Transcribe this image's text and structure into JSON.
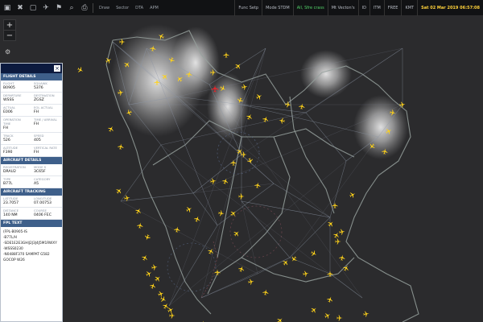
{
  "toolbar": {
    "left_icons": [
      {
        "icon": "layers-icon",
        "glyph": "▣"
      },
      {
        "icon": "trash-icon",
        "glyph": "✖"
      },
      {
        "icon": "delete-icon",
        "glyph": "▢"
      },
      {
        "icon": "route-icon",
        "glyph": "✈"
      },
      {
        "icon": "flag-icon",
        "glyph": "⚑"
      },
      {
        "icon": "search-icon",
        "glyph": "⌕"
      },
      {
        "icon": "print-icon",
        "glyph": "⎙"
      }
    ],
    "left_buttons": [
      "Draw",
      "Sector",
      "DTA",
      "APM"
    ],
    "right_items": [
      {
        "label": "Func Setp",
        "style": "normal"
      },
      {
        "label": "Mode STDM",
        "style": "normal"
      },
      {
        "label": "All, Sfre crass",
        "style": "green"
      },
      {
        "label": "Mt Vecton's",
        "style": "normal"
      },
      {
        "label": "ID",
        "style": "normal"
      },
      {
        "label": "ITM",
        "style": "normal"
      },
      {
        "label": "FREE",
        "style": "normal"
      },
      {
        "label": "KMT",
        "style": "normal"
      },
      {
        "label": "Sat 02 Mar 2019 06:57:08",
        "style": "clock"
      }
    ]
  },
  "map_controls": {
    "zoom_in": "+",
    "zoom_out": "−",
    "settings_icon": "gear-icon"
  },
  "panel": {
    "close_label": "×",
    "flight_details": {
      "heading": "FLIGHT DETAILS",
      "fields": [
        {
          "label": "FLIGHT",
          "value": "B0905"
        },
        {
          "label": "SQUAWK",
          "value": "5376"
        },
        {
          "label": "DEPARTURE",
          "value": "WSSS"
        },
        {
          "label": "DESTINATION",
          "value": "ZGSZ"
        },
        {
          "label": "ACTUAL",
          "value": "E006"
        },
        {
          "label": "EOL ACTUAL",
          "value": "FH"
        },
        {
          "label": "OPERATION TIME",
          "value": "FH"
        },
        {
          "label": "TIME / ARRIVAL",
          "value": "FH"
        },
        {
          "label": "TRACK",
          "value": "526"
        },
        {
          "label": "SPEED",
          "value": "405"
        },
        {
          "label": "ALTITUDE",
          "value": "F390"
        },
        {
          "label": "VERTICAL RATE",
          "value": "FH"
        }
      ]
    },
    "aircraft_details": {
      "heading": "AIRCRAFT DETAILS",
      "fields": [
        {
          "label": "REGISTRATION",
          "value": "DRAU2"
        },
        {
          "label": "MODE S",
          "value": "3C65F"
        },
        {
          "label": "TYPE",
          "value": "B77L"
        },
        {
          "label": "CATEGORY",
          "value": "A5"
        }
      ]
    },
    "aircraft_tracking": {
      "heading": "AIRCRAFT TRACKING",
      "fields": [
        {
          "label": "LATITUDE",
          "value": "23.7057"
        },
        {
          "label": "LONGITUDE",
          "value": "07.00753"
        },
        {
          "label": "DISTANCE",
          "value": "140 NM"
        },
        {
          "label": "COURSE",
          "value": "0406 FEC"
        }
      ]
    },
    "fpl_text": {
      "heading": "FPL TEXT",
      "lines": [
        "(FPL-B0905-IS",
        "-B77L/H",
        "-SDE1E2E3GHIJ2J3J4J5M1RWXY",
        "-WSSS0230",
        "-N0488F370 SAMPAT G582 GOCOP W26"
      ]
    }
  },
  "map_data": {
    "background": "#2b2b2d",
    "coastline_color": "#96a19e",
    "airway_color": "#8d97a6",
    "aircraft_color": "#ffd21a",
    "selected_color": "#e6242a",
    "weather_color": "#ffffff"
  }
}
